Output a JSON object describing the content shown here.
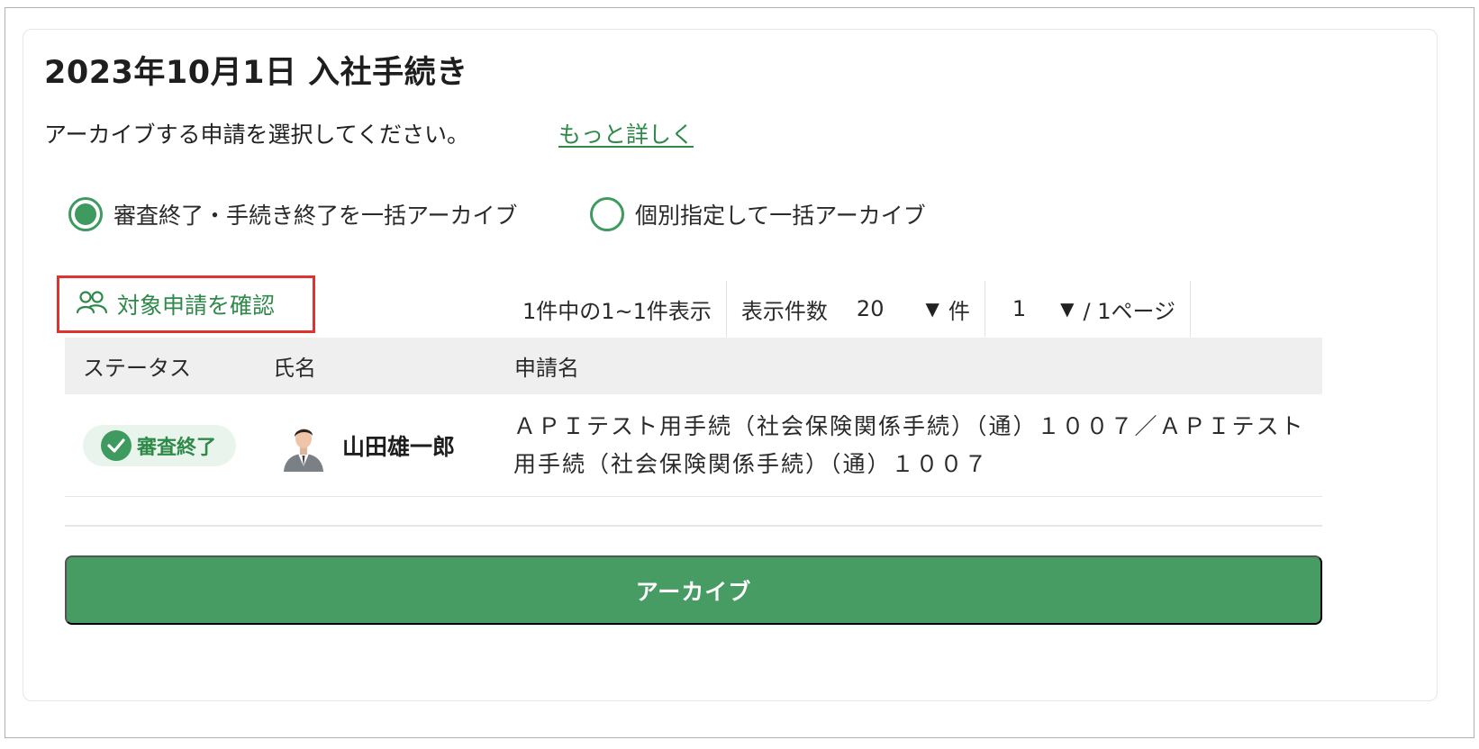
{
  "page": {
    "title": "2023年10月1日 入社手続き",
    "description": "アーカイブする申請を選択してください。",
    "more_link": "もっと詳しく"
  },
  "options": [
    {
      "label": "審査終了・手続き終了を一括アーカイブ",
      "selected": true
    },
    {
      "label": "個別指定して一括アーカイブ",
      "selected": false
    }
  ],
  "confirm": {
    "icon": "users-icon",
    "label": "対象申請を確認"
  },
  "pager": {
    "count_text": "1件中の1~1件表示",
    "per_page_label": "表示件数",
    "per_page_value": "20",
    "per_page_unit": "件",
    "page_value": "1",
    "page_total": "/ 1ページ"
  },
  "table": {
    "columns": [
      "ステータス",
      "氏名",
      "申請名"
    ],
    "rows": [
      {
        "status": "審査終了",
        "name": "山田雄一郎",
        "application": "ＡＰＩテスト用手続（社会保険関係手続）（通）１００７／ＡＰＩテスト用手続（社会保険関係手続）（通）１００７"
      }
    ]
  },
  "archive_button": "アーカイブ",
  "colors": {
    "accent": "#479c63",
    "link": "#2f8a4a",
    "highlight_border": "#e0322f",
    "badge_bg": "#e9f5ec"
  }
}
